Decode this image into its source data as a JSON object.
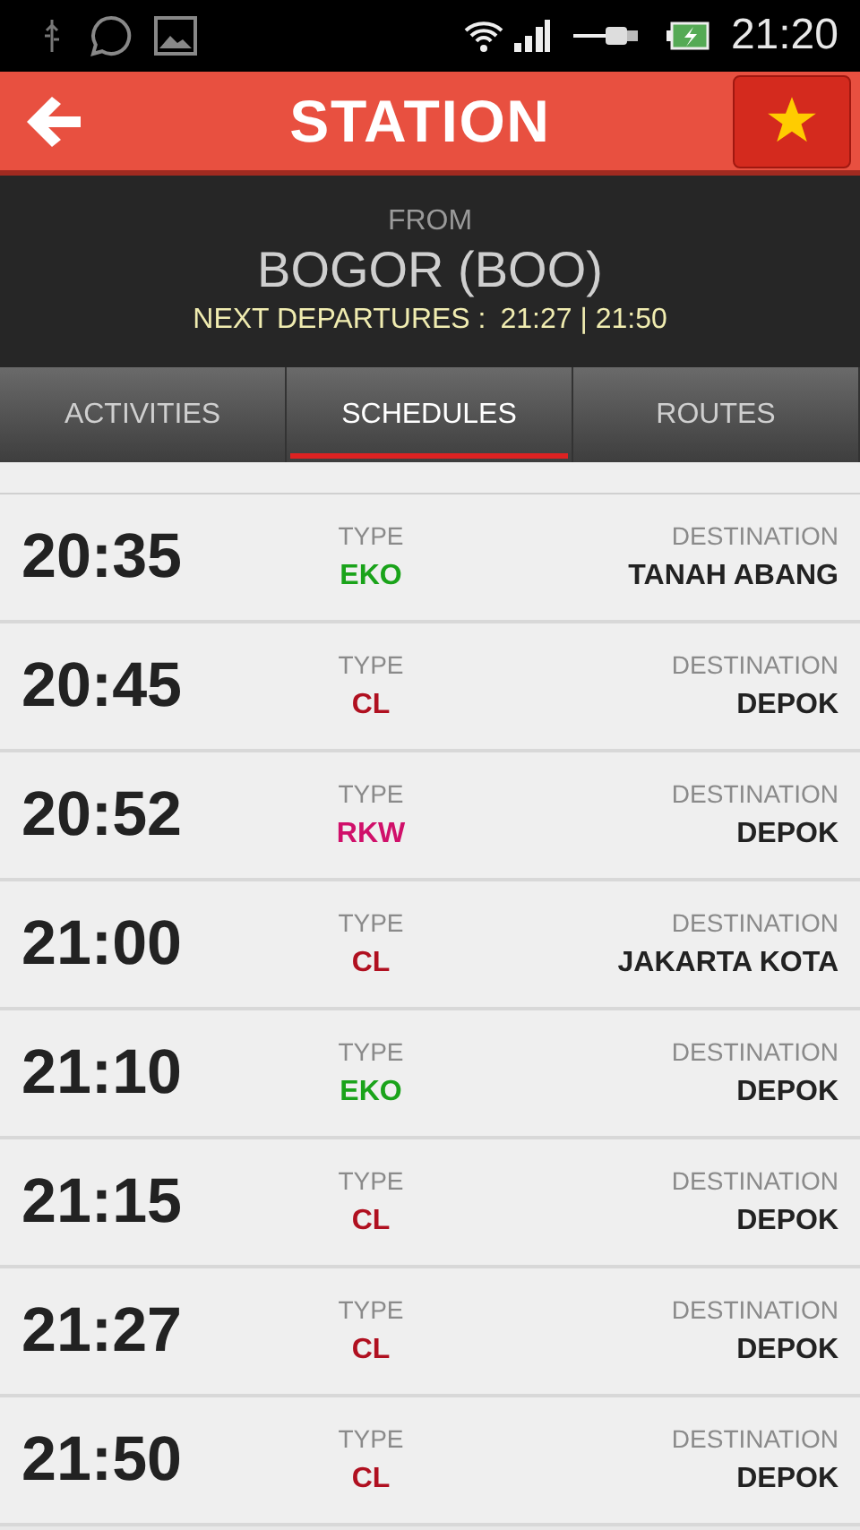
{
  "status_bar": {
    "time": "21:20"
  },
  "header": {
    "title": "STATION"
  },
  "station": {
    "from_label": "FROM",
    "name": "BOGOR (BOO)",
    "next_label": "NEXT DEPARTURES :",
    "next_times": "21:27 | 21:50"
  },
  "tabs": [
    {
      "label": "ACTIVITIES",
      "selected": false
    },
    {
      "label": "SCHEDULES",
      "selected": true
    },
    {
      "label": "ROUTES",
      "selected": false
    }
  ],
  "schedules": [
    {
      "time": "20:35",
      "type_label": "TYPE",
      "type": "EKO",
      "color": "#1aa31a",
      "destination_label": "DESTINATION",
      "destination": "TANAH ABANG"
    },
    {
      "time": "20:45",
      "type_label": "TYPE",
      "type": "CL",
      "color": "#b01020",
      "destination_label": "DESTINATION",
      "destination": "DEPOK"
    },
    {
      "time": "20:52",
      "type_label": "TYPE",
      "type": "RKW",
      "color": "#d0106a",
      "destination_label": "DESTINATION",
      "destination": "DEPOK"
    },
    {
      "time": "21:00",
      "type_label": "TYPE",
      "type": "CL",
      "color": "#b01020",
      "destination_label": "DESTINATION",
      "destination": "JAKARTA KOTA"
    },
    {
      "time": "21:10",
      "type_label": "TYPE",
      "type": "EKO",
      "color": "#1aa31a",
      "destination_label": "DESTINATION",
      "destination": "DEPOK"
    },
    {
      "time": "21:15",
      "type_label": "TYPE",
      "type": "CL",
      "color": "#b01020",
      "destination_label": "DESTINATION",
      "destination": "DEPOK"
    },
    {
      "time": "21:27",
      "type_label": "TYPE",
      "type": "CL",
      "color": "#b01020",
      "destination_label": "DESTINATION",
      "destination": "DEPOK"
    },
    {
      "time": "21:50",
      "type_label": "TYPE",
      "type": "CL",
      "color": "#b01020",
      "destination_label": "DESTINATION",
      "destination": "DEPOK"
    }
  ]
}
